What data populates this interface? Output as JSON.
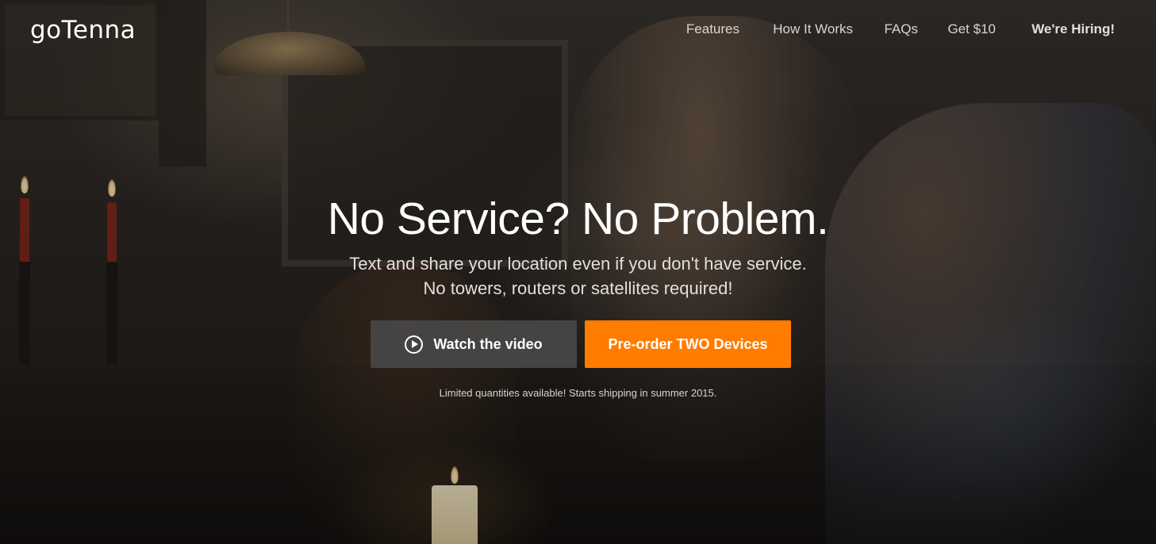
{
  "brand": {
    "logo_text": "goTenna"
  },
  "nav": {
    "items": [
      {
        "label": "Features"
      },
      {
        "label": "How It Works"
      },
      {
        "label": "FAQs"
      },
      {
        "label": "Get $10"
      },
      {
        "label": "We're Hiring!"
      }
    ]
  },
  "hero": {
    "headline": "No Service? No Problem.",
    "subline_1": "Text and share your location even if you don't have service.",
    "subline_2": "No towers, routers or satellites required!",
    "watch_button_label": "Watch the video",
    "watch_button_icon": "play-circle-icon",
    "preorder_button_label": "Pre-order TWO Devices",
    "availability_note": "Limited quantities available! Starts shipping in summer 2015."
  },
  "colors": {
    "accent_orange": "#ff7c00",
    "video_button_gray": "#484848",
    "text_white": "#ffffff"
  }
}
